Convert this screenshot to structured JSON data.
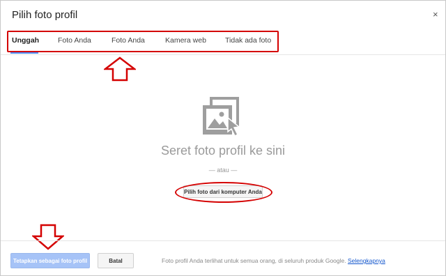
{
  "dialog": {
    "title": "Pilih foto profil",
    "close_glyph": "×"
  },
  "tabs": [
    {
      "label": "Unggah",
      "active": true
    },
    {
      "label": "Foto Anda",
      "active": false
    },
    {
      "label": "Foto Anda",
      "active": false
    },
    {
      "label": "Kamera web",
      "active": false
    },
    {
      "label": "Tidak ada foto",
      "active": false
    }
  ],
  "upload": {
    "icon": "photo-upload-icon",
    "drop_text": "Seret foto profil ke sini",
    "or_text": "— atau —",
    "pick_button": "Pilih foto dari komputer Anda"
  },
  "footer": {
    "set_button": "Tetapkan sebagai foto profil",
    "cancel_button": "Batal",
    "note": "Foto profil Anda terlihat untuk semua orang, di seluruh produk Google. ",
    "learn_more": "Selengkapnya"
  },
  "colors": {
    "annotation_red": "#d40000",
    "accent_blue": "#4d90fe",
    "link_blue": "#1155cc",
    "primary_disabled": "#a6c3f7"
  }
}
